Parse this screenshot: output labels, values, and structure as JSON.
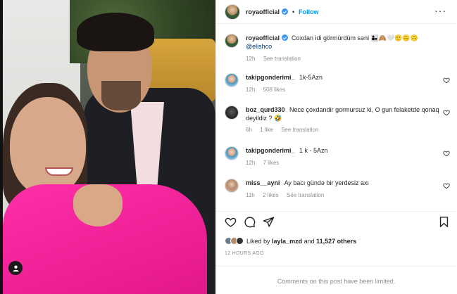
{
  "header": {
    "username": "royaofficial",
    "separator": "•",
    "follow_label": "Follow",
    "more_label": "···"
  },
  "caption": {
    "username": "royaofficial",
    "text": "Coxdan idi görmürdüm səni 👩‍👧🙈🤍🙂🙃🙃",
    "mention": "@elishco",
    "time": "12h",
    "see_translation": "See translation"
  },
  "comments": [
    {
      "username": "takipgonderimi_",
      "text": "1k-5Azn",
      "time": "12h",
      "likes": "508 likes",
      "extra": ""
    },
    {
      "username": "boz_qurd330",
      "text": "Nece çoxdandir gormursuz ki, O gun felaketde qonaq deyildiz ? 🤣",
      "time": "6h",
      "likes": "1 like",
      "extra": "See translation"
    },
    {
      "username": "takipgonderimi_",
      "text": "1 k - 5Azn",
      "time": "12h",
      "likes": "7 likes",
      "extra": ""
    },
    {
      "username": "miss__ayni",
      "text": "Ay bacı gündə bir yerdesiz axı",
      "time": "11h",
      "likes": "2 likes",
      "extra": "See translation"
    }
  ],
  "likes": {
    "prefix": "Liked by",
    "user": "layla_mzd",
    "and": "and",
    "others": "11,527 others"
  },
  "timestamp": "12 HOURS AGO",
  "limited_notice": "Comments on this post have been limited.",
  "icons": {
    "heart": "heart-icon",
    "comment": "comment-icon",
    "share": "share-icon",
    "save": "bookmark-icon",
    "user_tag": "user-tag-icon"
  },
  "colors": {
    "accent": "#0095f6",
    "verified": "#3897f0",
    "muted": "#8e8e8e",
    "text": "#262626"
  }
}
